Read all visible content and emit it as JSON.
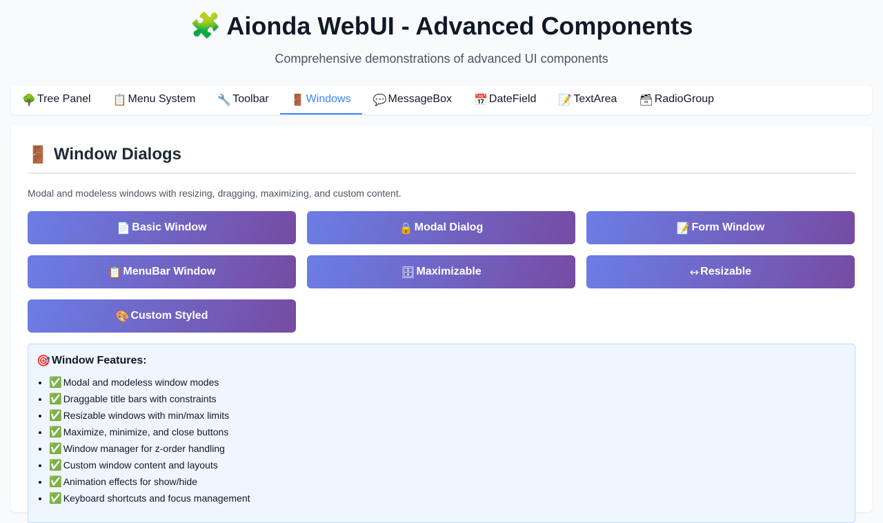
{
  "header": {
    "icon": "🧩",
    "title": "Aionda WebUI - Advanced Components",
    "subtitle": "Comprehensive demonstrations of advanced UI components"
  },
  "tabs": [
    {
      "icon": "🌳",
      "label": "Tree Panel",
      "active": false
    },
    {
      "icon": "📋",
      "label": "Menu System",
      "active": false
    },
    {
      "icon": "🔧",
      "label": "Toolbar",
      "active": false
    },
    {
      "icon": "🚪",
      "label": "Windows",
      "active": true
    },
    {
      "icon": "💬",
      "label": "MessageBox",
      "active": false
    },
    {
      "icon": "📅",
      "label": "DateField",
      "active": false
    },
    {
      "icon": "📝",
      "label": "TextArea",
      "active": false
    },
    {
      "icon": "🗃",
      "label": "RadioGroup",
      "active": false
    }
  ],
  "panel": {
    "icon": "🚪",
    "title": "Window Dialogs",
    "description": "Modal and modeless windows with resizing, dragging, maximizing, and custom content."
  },
  "buttons": [
    {
      "icon": "📄",
      "label": "Basic Window"
    },
    {
      "icon": "🔒",
      "label": "Modal Dialog"
    },
    {
      "icon": "📝",
      "label": "Form Window"
    },
    {
      "icon": "📋",
      "label": "MenuBar Window"
    },
    {
      "icon": "🗄",
      "label": " Maximizable"
    },
    {
      "icon": "↔",
      "label": "Resizable"
    },
    {
      "icon": "🎨",
      "label": "Custom Styled"
    }
  ],
  "features": {
    "icon": "🎯",
    "title": "Window Features:",
    "check_icon": "✅",
    "items": [
      "Modal and modeless window modes",
      "Draggable title bars with constraints",
      "Resizable windows with min/max limits",
      "Maximize, minimize, and close buttons",
      "Window manager for z-order handling",
      "Custom window content and layouts",
      "Animation effects for show/hide",
      "Keyboard shortcuts and focus management"
    ]
  },
  "colors": {
    "accent": "#3b82f6",
    "button_gradient_start": "#6b7ee6",
    "button_gradient_end": "#764ba2",
    "feature_bg": "#eff6ff"
  }
}
